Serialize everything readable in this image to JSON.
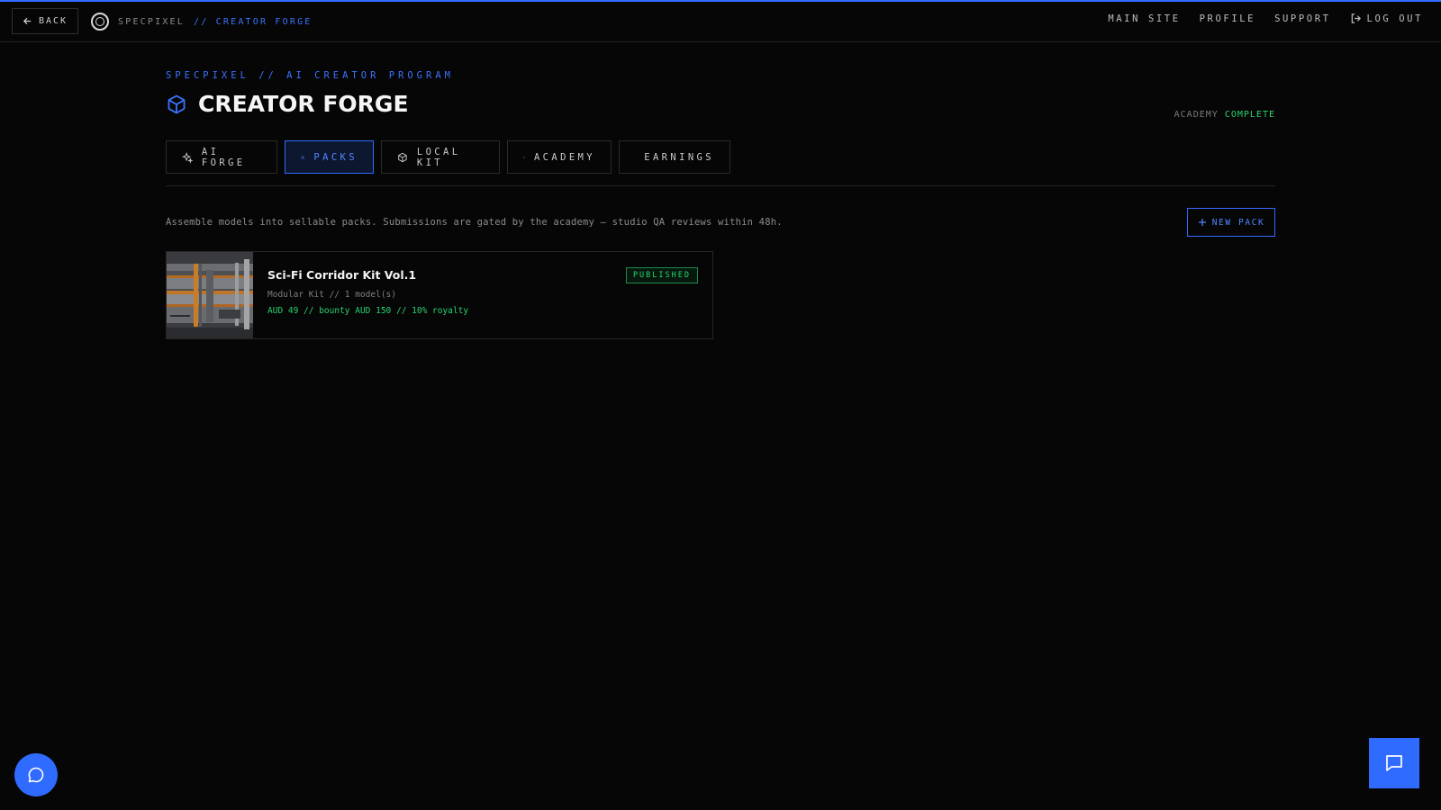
{
  "topbar": {
    "back_label": "BACK",
    "brand_name": "SPECPIXEL",
    "brand_section": "// CREATOR FORGE",
    "nav": [
      "MAIN SITE",
      "PROFILE",
      "SUPPORT"
    ],
    "logout_label": "LOG OUT"
  },
  "header": {
    "eyebrow": "SPECPIXEL // AI CREATOR PROGRAM",
    "title": "CREATOR FORGE",
    "academy_label": "ACADEMY",
    "academy_value": "COMPLETE"
  },
  "tabs": [
    {
      "label": "AI FORGE",
      "icon": "sparkle-icon",
      "active": false
    },
    {
      "label": "PACKS",
      "icon": "layers-icon",
      "active": true
    },
    {
      "label": "LOCAL KIT",
      "icon": "cube-icon",
      "active": false
    },
    {
      "label": "ACADEMY",
      "icon": "graduation-cap-icon",
      "active": false
    },
    {
      "label": "EARNINGS",
      "icon": "dollar-circle-icon",
      "active": false
    }
  ],
  "packs_view": {
    "description": "Assemble models into sellable packs. Submissions are gated by the academy — studio QA reviews within 48h.",
    "new_pack_label": "NEW PACK",
    "items": [
      {
        "title": "Sci-Fi Corridor Kit Vol.1",
        "meta": "Modular Kit // 1 model(s)",
        "price": "AUD 49 // bounty AUD 150 // 10% royalty",
        "status": "PUBLISHED"
      }
    ]
  },
  "colors": {
    "accent": "#2f6bff",
    "success": "#2bd36f",
    "background": "#060606",
    "border": "#262626"
  }
}
